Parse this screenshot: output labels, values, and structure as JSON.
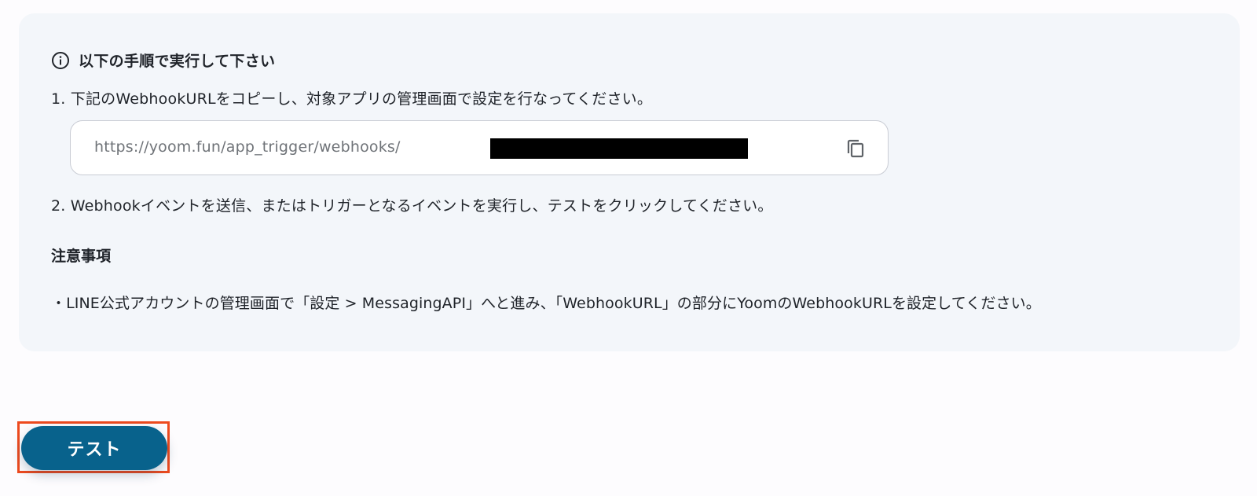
{
  "instructions": {
    "heading": "以下の手順で実行して下さい",
    "step1": "1. 下記のWebhookURLをコピーし、対象アプリの管理画面で設定を行なってください。",
    "webhook_url": "https://yoom.fun/app_trigger/webhooks/",
    "step2": "2. Webhookイベントを送信、またはトリガーとなるイベントを実行し、テストをクリックしてください。"
  },
  "notes": {
    "title": "注意事項",
    "body": "・LINE公式アカウントの管理画面で「設定 > MessagingAPI」へと進み、「WebhookURL」の部分にYoomのWebhookURLを設定してください。"
  },
  "actions": {
    "test_label": "テスト"
  },
  "icons": {
    "info": "info-circle-icon",
    "copy": "copy-icon"
  },
  "colors": {
    "panel_bg": "#f3f6fa",
    "primary_button": "#08628c",
    "highlight_border": "#ee4a1e",
    "redaction": "#000000"
  }
}
